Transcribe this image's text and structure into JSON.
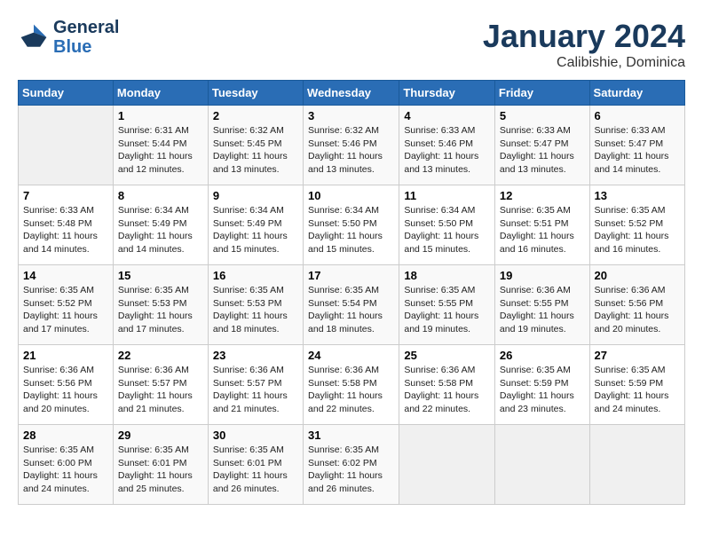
{
  "header": {
    "logo_line1": "General",
    "logo_line2": "Blue",
    "month": "January 2024",
    "location": "Calibishie, Dominica"
  },
  "weekdays": [
    "Sunday",
    "Monday",
    "Tuesday",
    "Wednesday",
    "Thursday",
    "Friday",
    "Saturday"
  ],
  "weeks": [
    [
      {
        "day": "",
        "sunrise": "",
        "sunset": "",
        "daylight": ""
      },
      {
        "day": "1",
        "sunrise": "Sunrise: 6:31 AM",
        "sunset": "Sunset: 5:44 PM",
        "daylight": "Daylight: 11 hours and 12 minutes."
      },
      {
        "day": "2",
        "sunrise": "Sunrise: 6:32 AM",
        "sunset": "Sunset: 5:45 PM",
        "daylight": "Daylight: 11 hours and 13 minutes."
      },
      {
        "day": "3",
        "sunrise": "Sunrise: 6:32 AM",
        "sunset": "Sunset: 5:46 PM",
        "daylight": "Daylight: 11 hours and 13 minutes."
      },
      {
        "day": "4",
        "sunrise": "Sunrise: 6:33 AM",
        "sunset": "Sunset: 5:46 PM",
        "daylight": "Daylight: 11 hours and 13 minutes."
      },
      {
        "day": "5",
        "sunrise": "Sunrise: 6:33 AM",
        "sunset": "Sunset: 5:47 PM",
        "daylight": "Daylight: 11 hours and 13 minutes."
      },
      {
        "day": "6",
        "sunrise": "Sunrise: 6:33 AM",
        "sunset": "Sunset: 5:47 PM",
        "daylight": "Daylight: 11 hours and 14 minutes."
      }
    ],
    [
      {
        "day": "7",
        "sunrise": "Sunrise: 6:33 AM",
        "sunset": "Sunset: 5:48 PM",
        "daylight": "Daylight: 11 hours and 14 minutes."
      },
      {
        "day": "8",
        "sunrise": "Sunrise: 6:34 AM",
        "sunset": "Sunset: 5:49 PM",
        "daylight": "Daylight: 11 hours and 14 minutes."
      },
      {
        "day": "9",
        "sunrise": "Sunrise: 6:34 AM",
        "sunset": "Sunset: 5:49 PM",
        "daylight": "Daylight: 11 hours and 15 minutes."
      },
      {
        "day": "10",
        "sunrise": "Sunrise: 6:34 AM",
        "sunset": "Sunset: 5:50 PM",
        "daylight": "Daylight: 11 hours and 15 minutes."
      },
      {
        "day": "11",
        "sunrise": "Sunrise: 6:34 AM",
        "sunset": "Sunset: 5:50 PM",
        "daylight": "Daylight: 11 hours and 15 minutes."
      },
      {
        "day": "12",
        "sunrise": "Sunrise: 6:35 AM",
        "sunset": "Sunset: 5:51 PM",
        "daylight": "Daylight: 11 hours and 16 minutes."
      },
      {
        "day": "13",
        "sunrise": "Sunrise: 6:35 AM",
        "sunset": "Sunset: 5:52 PM",
        "daylight": "Daylight: 11 hours and 16 minutes."
      }
    ],
    [
      {
        "day": "14",
        "sunrise": "Sunrise: 6:35 AM",
        "sunset": "Sunset: 5:52 PM",
        "daylight": "Daylight: 11 hours and 17 minutes."
      },
      {
        "day": "15",
        "sunrise": "Sunrise: 6:35 AM",
        "sunset": "Sunset: 5:53 PM",
        "daylight": "Daylight: 11 hours and 17 minutes."
      },
      {
        "day": "16",
        "sunrise": "Sunrise: 6:35 AM",
        "sunset": "Sunset: 5:53 PM",
        "daylight": "Daylight: 11 hours and 18 minutes."
      },
      {
        "day": "17",
        "sunrise": "Sunrise: 6:35 AM",
        "sunset": "Sunset: 5:54 PM",
        "daylight": "Daylight: 11 hours and 18 minutes."
      },
      {
        "day": "18",
        "sunrise": "Sunrise: 6:35 AM",
        "sunset": "Sunset: 5:55 PM",
        "daylight": "Daylight: 11 hours and 19 minutes."
      },
      {
        "day": "19",
        "sunrise": "Sunrise: 6:36 AM",
        "sunset": "Sunset: 5:55 PM",
        "daylight": "Daylight: 11 hours and 19 minutes."
      },
      {
        "day": "20",
        "sunrise": "Sunrise: 6:36 AM",
        "sunset": "Sunset: 5:56 PM",
        "daylight": "Daylight: 11 hours and 20 minutes."
      }
    ],
    [
      {
        "day": "21",
        "sunrise": "Sunrise: 6:36 AM",
        "sunset": "Sunset: 5:56 PM",
        "daylight": "Daylight: 11 hours and 20 minutes."
      },
      {
        "day": "22",
        "sunrise": "Sunrise: 6:36 AM",
        "sunset": "Sunset: 5:57 PM",
        "daylight": "Daylight: 11 hours and 21 minutes."
      },
      {
        "day": "23",
        "sunrise": "Sunrise: 6:36 AM",
        "sunset": "Sunset: 5:57 PM",
        "daylight": "Daylight: 11 hours and 21 minutes."
      },
      {
        "day": "24",
        "sunrise": "Sunrise: 6:36 AM",
        "sunset": "Sunset: 5:58 PM",
        "daylight": "Daylight: 11 hours and 22 minutes."
      },
      {
        "day": "25",
        "sunrise": "Sunrise: 6:36 AM",
        "sunset": "Sunset: 5:58 PM",
        "daylight": "Daylight: 11 hours and 22 minutes."
      },
      {
        "day": "26",
        "sunrise": "Sunrise: 6:35 AM",
        "sunset": "Sunset: 5:59 PM",
        "daylight": "Daylight: 11 hours and 23 minutes."
      },
      {
        "day": "27",
        "sunrise": "Sunrise: 6:35 AM",
        "sunset": "Sunset: 5:59 PM",
        "daylight": "Daylight: 11 hours and 24 minutes."
      }
    ],
    [
      {
        "day": "28",
        "sunrise": "Sunrise: 6:35 AM",
        "sunset": "Sunset: 6:00 PM",
        "daylight": "Daylight: 11 hours and 24 minutes."
      },
      {
        "day": "29",
        "sunrise": "Sunrise: 6:35 AM",
        "sunset": "Sunset: 6:01 PM",
        "daylight": "Daylight: 11 hours and 25 minutes."
      },
      {
        "day": "30",
        "sunrise": "Sunrise: 6:35 AM",
        "sunset": "Sunset: 6:01 PM",
        "daylight": "Daylight: 11 hours and 26 minutes."
      },
      {
        "day": "31",
        "sunrise": "Sunrise: 6:35 AM",
        "sunset": "Sunset: 6:02 PM",
        "daylight": "Daylight: 11 hours and 26 minutes."
      },
      {
        "day": "",
        "sunrise": "",
        "sunset": "",
        "daylight": ""
      },
      {
        "day": "",
        "sunrise": "",
        "sunset": "",
        "daylight": ""
      },
      {
        "day": "",
        "sunrise": "",
        "sunset": "",
        "daylight": ""
      }
    ]
  ]
}
